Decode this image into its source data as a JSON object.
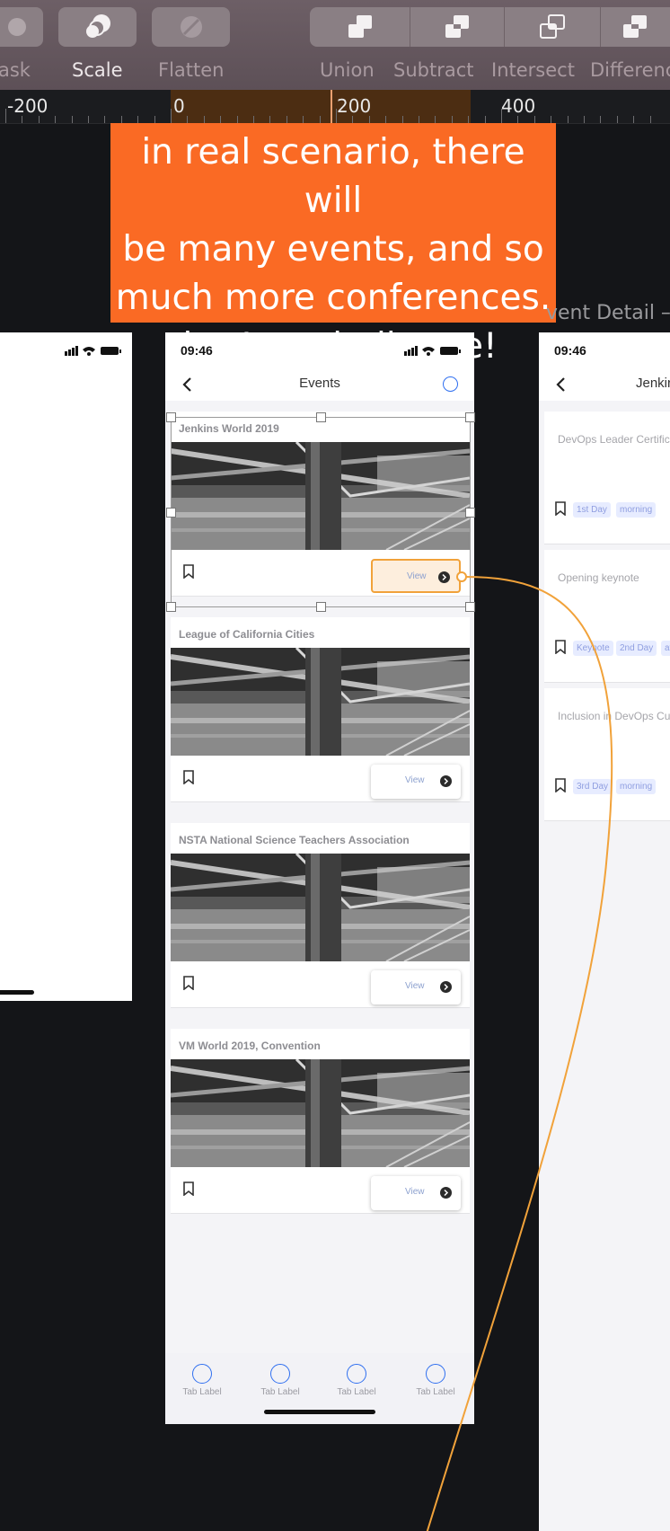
{
  "toolbar": {
    "tools": [
      {
        "label": "ask",
        "icon": "mask-icon",
        "active": false
      },
      {
        "label": "Scale",
        "icon": "scale-icon",
        "active": true
      },
      {
        "label": "Flatten",
        "icon": "flatten-icon",
        "active": false
      },
      {
        "label": "Union",
        "icon": "union-icon",
        "active": false
      },
      {
        "label": "Subtract",
        "icon": "subtract-icon",
        "active": false
      },
      {
        "label": "Intersect",
        "icon": "intersect-icon",
        "active": false
      },
      {
        "label": "Differenc",
        "icon": "difference-icon",
        "active": false
      }
    ]
  },
  "ruler": {
    "labels": [
      "-200",
      "0",
      "200",
      "400"
    ]
  },
  "annotation": {
    "lines": [
      "in real scenario, there will",
      "be many events, and so",
      "much more conferences.",
      "that’s a challange!"
    ]
  },
  "artboards": {
    "right_title": "vent Detail –"
  },
  "phone": {
    "status_time": "09:46",
    "nav_title": "Events",
    "view_label": "View",
    "events": [
      {
        "title": "Jenkins World 2019",
        "selected": true
      },
      {
        "title": "League of California Cities",
        "selected": false
      },
      {
        "title": "NSTA National Science Teachers Association",
        "selected": false
      },
      {
        "title": "VM World 2019, Convention",
        "selected": false
      }
    ],
    "tabs": [
      "Tab Label",
      "Tab Label",
      "Tab Label",
      "Tab Label"
    ]
  },
  "detail": {
    "status_time": "09:46",
    "nav_title": "Jenkir",
    "sessions": [
      {
        "title": "DevOps Leader Certific",
        "chips": [
          "1st Day",
          "morning"
        ]
      },
      {
        "title": "Opening keynote",
        "chips": [
          "Keynote",
          "2nd Day",
          "af"
        ]
      },
      {
        "title": "Inclusion in DevOps Cu",
        "chips": [
          "3rd Day",
          "morning"
        ]
      }
    ]
  },
  "colors": {
    "accent_orange": "#fa6a24",
    "prototype_link": "#f1a23a",
    "ios_blue": "#2f6ff0"
  }
}
